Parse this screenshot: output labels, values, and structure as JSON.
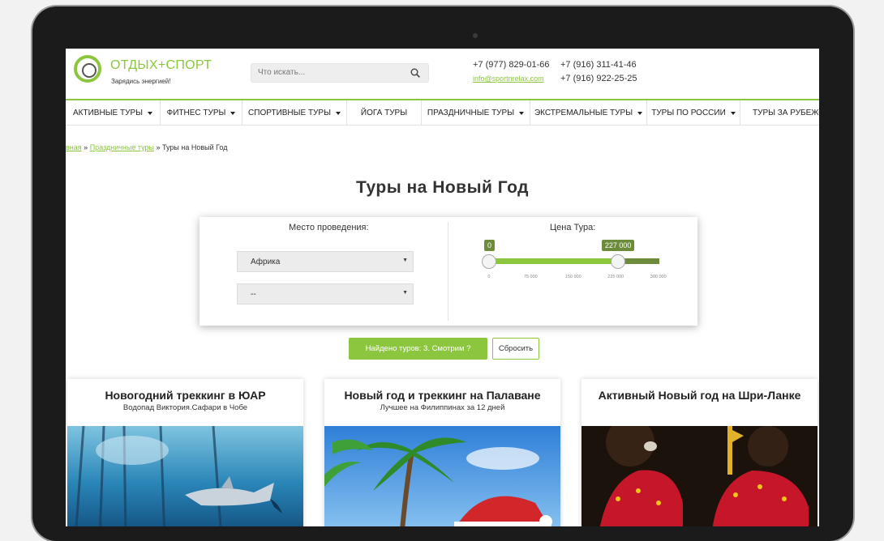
{
  "header": {
    "logo_title": "ОТДЫХ+СПОРТ",
    "logo_tagline": "Зарядись энергией!",
    "search_placeholder": "Что искать...",
    "phone1": "+7 (977) 829-01-66",
    "email": "info@sportnrelax.com",
    "phone2": "+7 (916) 311-41-46",
    "phone3": "+7 (916) 922-25-25"
  },
  "nav": {
    "items": [
      {
        "label": "АКТИВНЫЕ ТУРЫ",
        "dropdown": true
      },
      {
        "label": "ФИТНЕС ТУРЫ",
        "dropdown": true
      },
      {
        "label": "СПОРТИВНЫЕ ТУРЫ",
        "dropdown": true
      },
      {
        "label": "ЙОГА ТУРЫ",
        "dropdown": false
      },
      {
        "label": "ПРАЗДНИЧНЫЕ ТУРЫ",
        "dropdown": true
      },
      {
        "label": "ЭКСТРЕМАЛЬНЫЕ ТУРЫ",
        "dropdown": true
      },
      {
        "label": "ТУРЫ ПО РОССИИ",
        "dropdown": true
      },
      {
        "label": "ТУРЫ ЗА РУБЕЖОМ",
        "dropdown": false
      }
    ]
  },
  "breadcrumb": {
    "home": "вная",
    "section": "Праздничные туры",
    "separator": "»",
    "current": "Туры на Новый Год"
  },
  "page_title": "Туры на Новый Год",
  "filter": {
    "location_label": "Место проведения:",
    "location_value": "Африка",
    "sublocation_value": "--",
    "price_label": "Цена Тура:",
    "price_min": "0",
    "price_max": "227 000",
    "ticks": [
      "0",
      "75 000",
      "150 000",
      "225 000",
      "300 000"
    ],
    "range_min": 0,
    "range_max": 300000,
    "selected_min": 0,
    "selected_max": 227000
  },
  "actions": {
    "found_label": "Найдено туров: 3. Смотрим ?",
    "reset_label": "Сбросить"
  },
  "cards": [
    {
      "title": "Новогодний треккинг в ЮАР",
      "subtitle": "Водопад Виктория.Сафари в Чобе"
    },
    {
      "title": "Новый год и треккинг на Палаване",
      "subtitle": "Лучшее на Филиппинах за 12 дней"
    },
    {
      "title": "Активный Новый год на Шри-Ланке",
      "subtitle": ""
    }
  ],
  "colors": {
    "accent": "#8cc63f",
    "accent_dark": "#6c8c3c",
    "text": "#333333"
  }
}
